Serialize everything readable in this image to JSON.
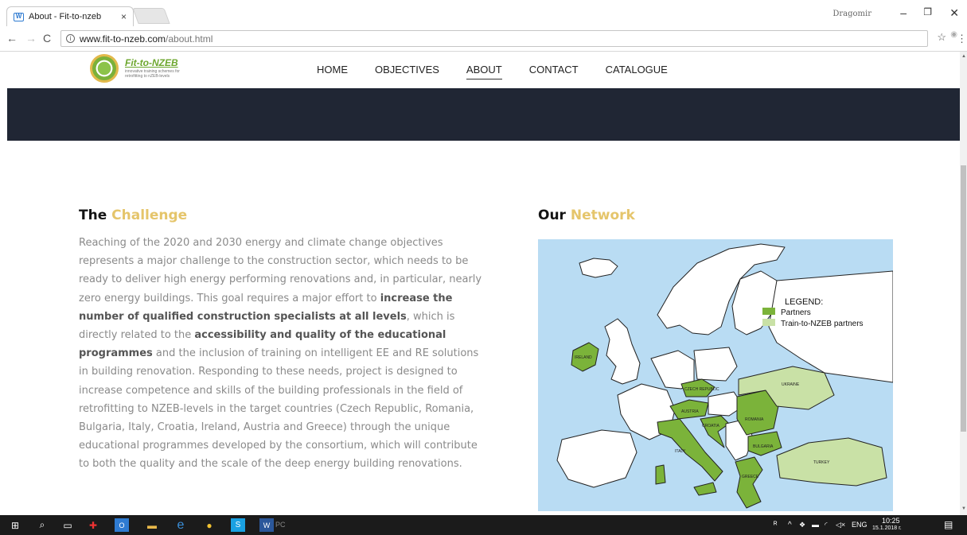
{
  "browser": {
    "tab_title": "About - Fit-to-nzeb",
    "tab_close": "×",
    "favicon": "W",
    "user_name": "Dragomir",
    "url_host": "www.fit-to-nzeb.com",
    "url_path": "/about.html"
  },
  "site": {
    "logo_name": "Fit-to-NZEB",
    "logo_tagline": "innovative training schemes for retrofitting to nZEB-levels",
    "nav": [
      "HOME",
      "OBJECTIVES",
      "ABOUT",
      "CONTACT",
      "CATALOGUE"
    ],
    "active_nav": "ABOUT"
  },
  "challenge": {
    "heading_plain": "The",
    "heading_accent": "Challenge",
    "p1": "Reaching of the 2020 and 2030 energy and climate change objectives represents a major challenge to the construction sector, which needs to be ready to deliver high energy performing renovations and, in particular, nearly zero energy buildings. This goal requires a major effort to ",
    "b1": "increase the number of qualified construction specialists at all levels",
    "p2": ", which is directly related to the ",
    "b2": "accessibility and quality of the educational programmes",
    "p3": " and the inclusion of training on intelligent EE and RE solutions in building renovation. Responding to these needs, project is designed to increase competence and skills of the building professionals in the field of retrofitting to NZEB-levels in the target countries (Czech Republic, Romania, Bulgaria, Italy, Croatia, Ireland, Austria and Greece) through the unique educational programmes developed by the consortium, which will contribute to both the quality and the scale of the deep energy building renovations."
  },
  "network": {
    "heading_plain": "Our",
    "heading_accent": "Network",
    "legend_title": "LEGEND:",
    "legend_partners": "Partners",
    "legend_train": "Train-to-NZEB partners",
    "labels": {
      "ireland": "IRELAND",
      "czech": "CZECH REPUBLIC",
      "austria": "AUSTRIA",
      "croatia": "CROATIA",
      "romania": "ROMANIA",
      "bulgaria": "BULGARIA",
      "italy": "ITALY",
      "greece": "GREECE",
      "ukraine": "UKRAINE",
      "turkey": "TURKEY"
    },
    "colors": {
      "sea": "#b9dcf3",
      "partner": "#7bb33a",
      "train": "#c9e1a6",
      "land": "#ffffff"
    }
  },
  "taskbar": {
    "time": "10:25",
    "date": "15.1.2018 г.",
    "lang": "ENG",
    "running_label": "PC"
  }
}
